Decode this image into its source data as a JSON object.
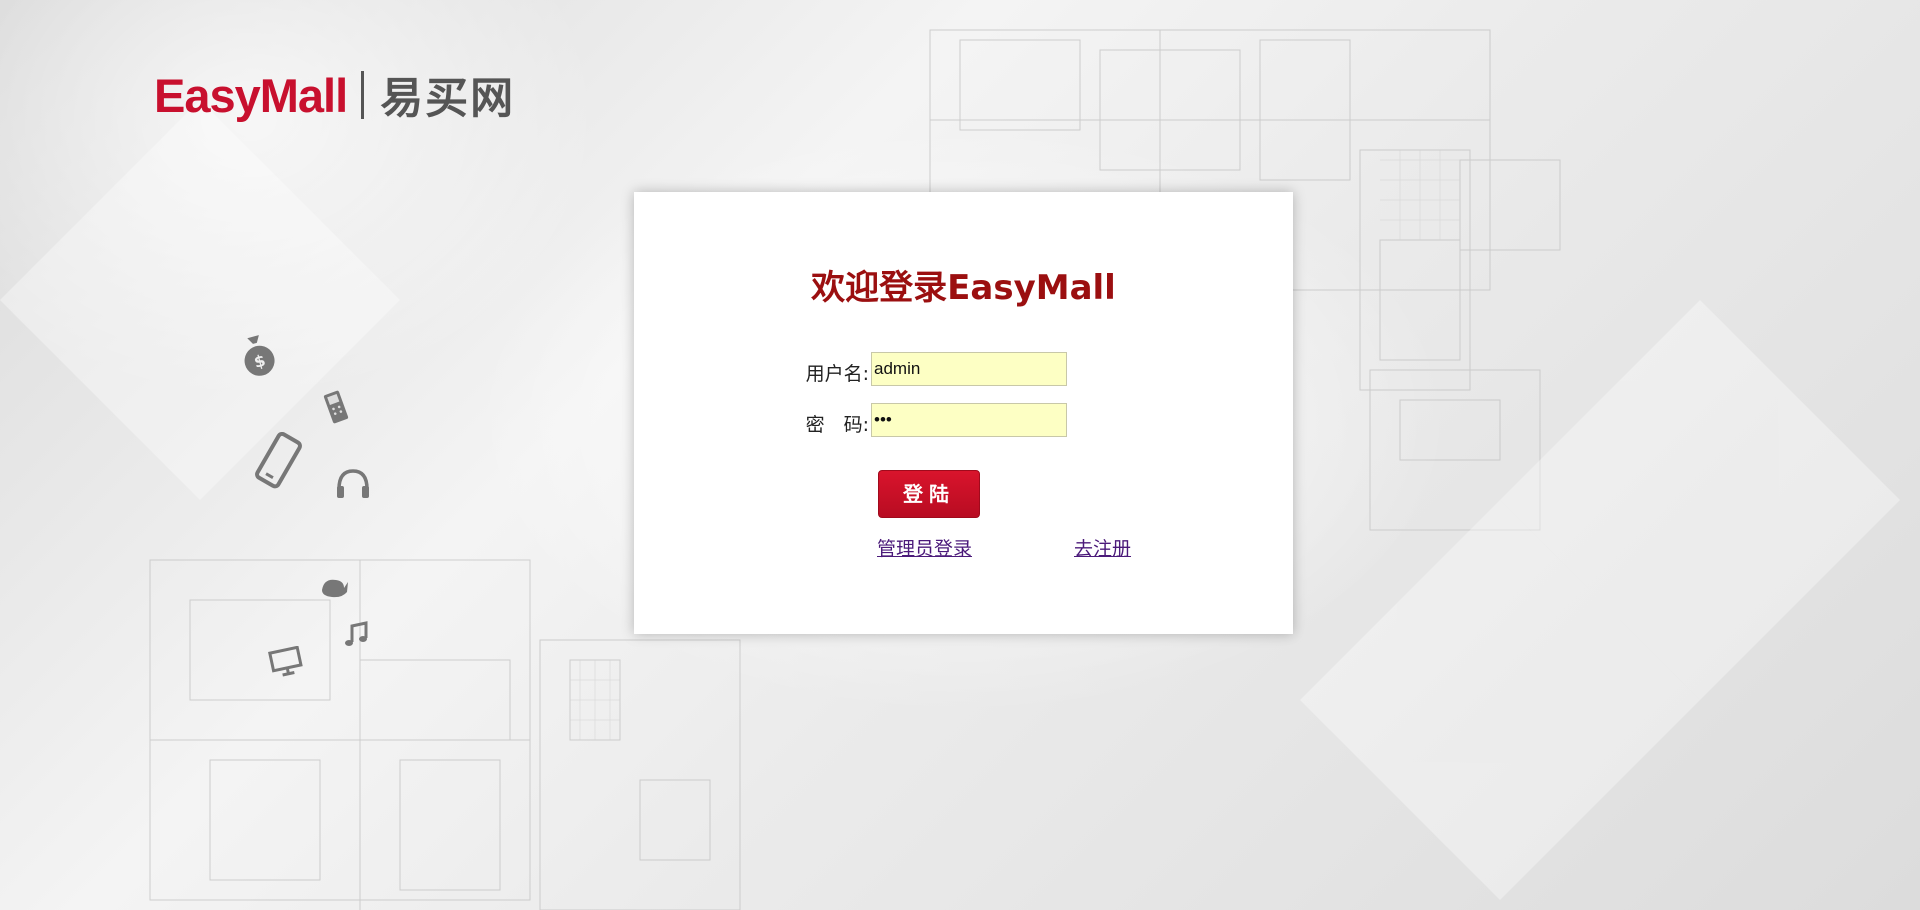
{
  "brand": {
    "name_en": "EasyMall",
    "name_cn": "易买网"
  },
  "login": {
    "title": "欢迎登录EasyMall",
    "username_label": "用户名:",
    "username_value": "admin",
    "password_label": "密　码:",
    "password_value": "•••",
    "submit_label": "登陆",
    "admin_link": "管理员登录",
    "register_link": "去注册"
  },
  "decor_icons": [
    "money-bag-icon",
    "phone-icon",
    "smartphone-icon",
    "headphones-icon",
    "whale-icon",
    "music-note-icon",
    "monitor-icon"
  ],
  "colors": {
    "brand_red": "#c8102e",
    "title_red": "#9b0f10",
    "input_bg": "#fdffc4",
    "link": "#4b1a7a"
  }
}
